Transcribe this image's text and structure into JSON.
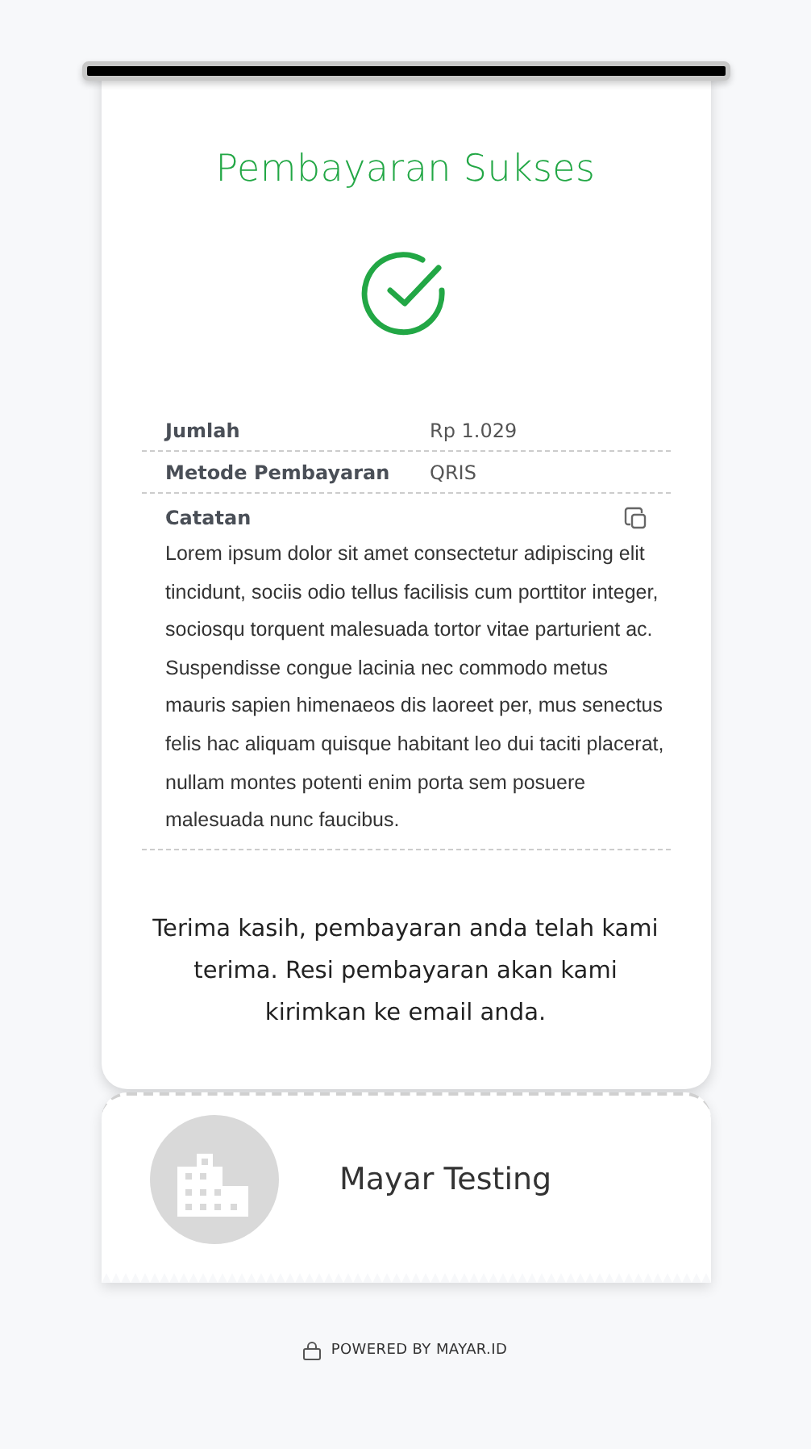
{
  "receipt": {
    "title": "Pembayaran Sukses",
    "details": [
      {
        "label": "Jumlah",
        "value": "Rp 1.029"
      },
      {
        "label": "Metode Pembayaran",
        "value": "QRIS"
      }
    ],
    "note": {
      "label": "Catatan",
      "text": "Lorem ipsum dolor sit amet consectetur adipiscing elit tincidunt, sociis odio tellus facilisis cum porttitor integer, sociosqu torquent malesuada tortor vitae parturient ac. Suspendisse congue lacinia nec commodo metus mauris sapien himenaeos dis laoreet per, mus senectus felis hac aliquam quisque habitant leo dui taciti placerat, nullam montes potenti enim porta sem posuere malesuada nunc faucibus."
    },
    "message": "Terima kasih, pembayaran anda telah kami terima. Resi pembayaran akan kami kirimkan ke email anda."
  },
  "merchant": {
    "name": "Mayar Testing"
  },
  "footer": "POWERED BY MAYAR.ID"
}
